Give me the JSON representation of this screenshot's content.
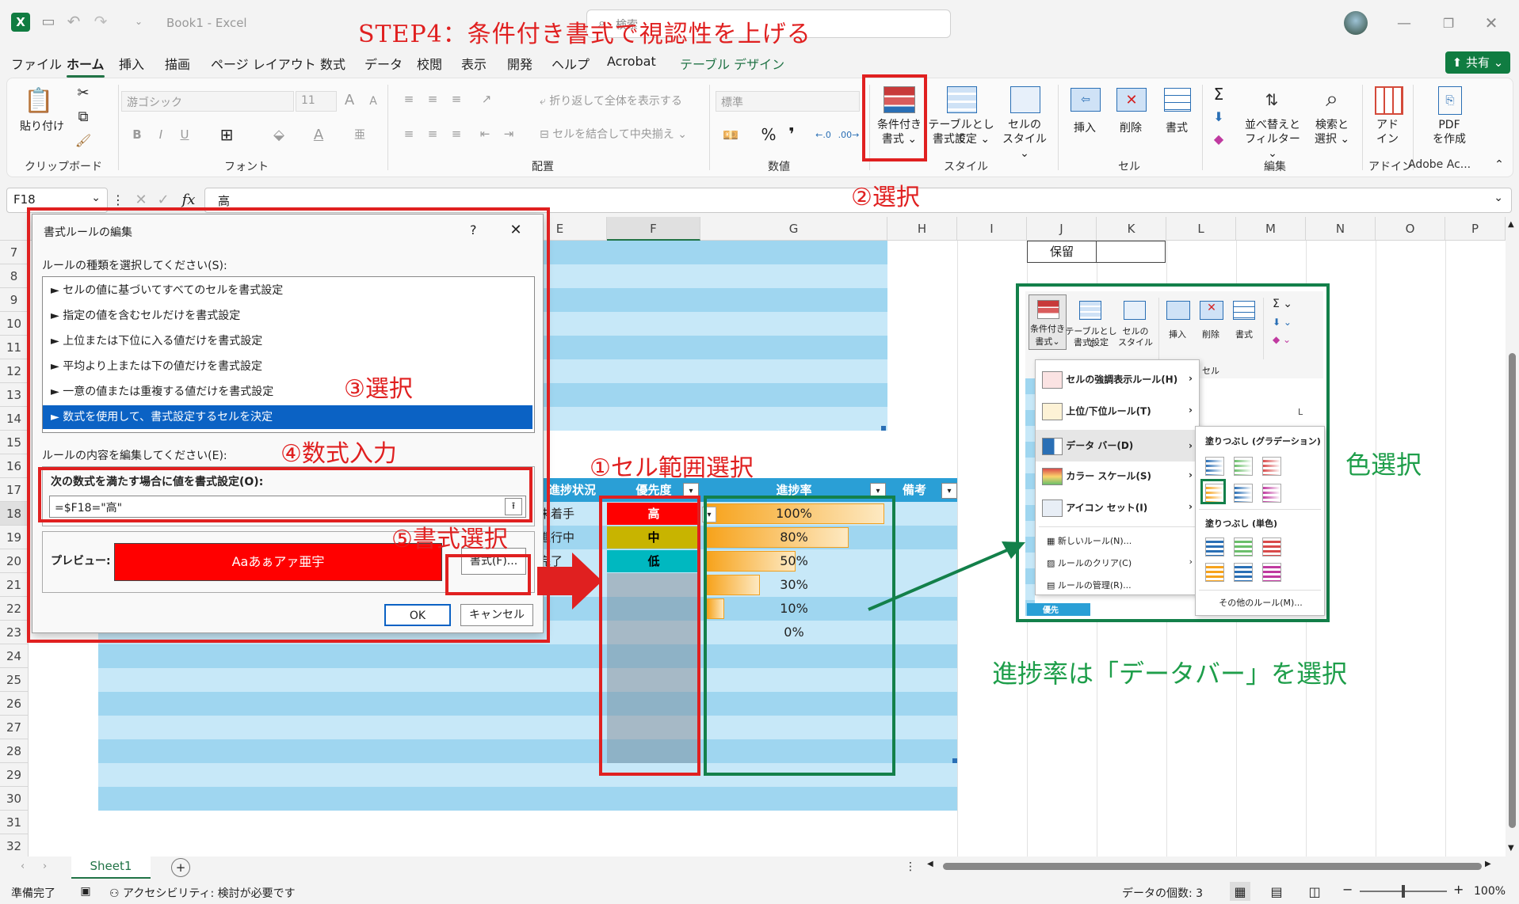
{
  "title": {
    "file": "Book1",
    "sep": "-",
    "app": "Excel",
    "search": "検索",
    "share": "共有"
  },
  "tabs": [
    "ファイル",
    "ホーム",
    "挿入",
    "描画",
    "ページ レイアウト",
    "数式",
    "データ",
    "校閲",
    "表示",
    "開発",
    "ヘルプ",
    "Acrobat",
    "テーブル デザイン"
  ],
  "ribbon": {
    "paste": "貼り付け",
    "clipboard": "クリップボード",
    "font_name": "游ゴシック",
    "font_size": "11",
    "font": "フォント",
    "wrap": "折り返して全体を表示する",
    "merge": "セルを結合して中央揃え",
    "align": "配置",
    "numfmt": "標準",
    "number": "数値",
    "cond_format_1": "条件付き",
    "cond_format_2": "書式",
    "table_fmt_1": "テーブルとして",
    "table_fmt_2": "書式設定",
    "cell_style_1": "セルの",
    "cell_style_2": "スタイル",
    "style": "スタイル",
    "insert": "挿入",
    "delete": "削除",
    "format": "書式",
    "cells": "セル",
    "sort_1": "並べ替えと",
    "sort_2": "フィルター",
    "find_1": "検索と",
    "find_2": "選択",
    "edit": "編集",
    "addin_1": "アド",
    "addin_2": "イン",
    "addin": "アドイン",
    "pdf_1": "PDF",
    "pdf_2": "を作成",
    "adobe": "Adobe Ac..."
  },
  "formula_bar": {
    "namebox": "F18",
    "fx": "fx",
    "value": "高"
  },
  "columns": [
    "E",
    "F",
    "G",
    "H",
    "I",
    "J",
    "K",
    "L",
    "M",
    "N",
    "O",
    "P"
  ],
  "rows": [
    "7",
    "8",
    "9",
    "10",
    "11",
    "12",
    "13",
    "14",
    "15",
    "16",
    "17",
    "18",
    "19",
    "20",
    "21",
    "22",
    "23",
    "24",
    "25",
    "26",
    "27",
    "28",
    "29",
    "30",
    "31",
    "32"
  ],
  "sheet": {
    "hold": "保留",
    "headers": {
      "status": "進捗状況",
      "priority": "優先度",
      "progress": "進捗率",
      "notes": "備考"
    },
    "status_values": [
      "未着手",
      "進行中",
      "完了"
    ],
    "priority_values": [
      {
        "label": "高",
        "color": "#ff0000",
        "text": "#ffffff"
      },
      {
        "label": "中",
        "color": "#c8b400",
        "text": "#000000"
      },
      {
        "label": "低",
        "color": "#00b8c0",
        "text": "#000000"
      }
    ],
    "progress_values": [
      {
        "label": "100%",
        "value": 1.0
      },
      {
        "label": "80%",
        "value": 0.8
      },
      {
        "label": "50%",
        "value": 0.5
      },
      {
        "label": "30%",
        "value": 0.3
      },
      {
        "label": "10%",
        "value": 0.1
      },
      {
        "label": "0%",
        "value": 0.0
      }
    ]
  },
  "dialog": {
    "title": "書式ルールの編集",
    "help": "?",
    "rule_type_label": "ルールの種類を選択してください(S):",
    "rules": [
      "セルの値に基づいてすべてのセルを書式設定",
      "指定の値を含むセルだけを書式設定",
      "上位または下位に入る値だけを書式設定",
      "平均より上または下の値だけを書式設定",
      "一意の値または重複する値だけを書式設定",
      "数式を使用して、書式設定するセルを決定"
    ],
    "edit_label": "ルールの内容を編集してください(E):",
    "formula_label": "次の数式を満たす場合に値を書式設定(O):",
    "formula": "=$F18=\"高\"",
    "preview_label": "プレビュー:",
    "preview_text": "Aaあぁアァ亜宇",
    "format_button": "書式(F)...",
    "ok": "OK",
    "cancel": "キャンセル"
  },
  "inset": {
    "cond_1": "条件付き",
    "cond_2": "書式",
    "table_1": "テーブルとして",
    "table_2": "書式設定",
    "cell_1": "セルの",
    "cell_2": "スタイル",
    "insert": "挿入",
    "delete": "削除",
    "format": "書式",
    "cells": "セル",
    "col_k": "K",
    "col_l": "L",
    "menu": [
      "セルの強調表示ルール(H)",
      "上位/下位ルール(T)",
      "データ バー(D)",
      "カラー スケール(S)",
      "アイコン セット(I)"
    ],
    "menu_small": [
      "新しいルール(N)...",
      "ルールのクリア(C)",
      "ルールの管理(R)..."
    ],
    "gradient_title": "塗りつぶし (グラデーション)",
    "solid_title": "塗りつぶし (単色)",
    "other_rules": "その他のルール(M)...",
    "bottom_text": "優先"
  },
  "annotations": {
    "step": "STEP4：条件付き書式で視認性を上げる",
    "a1": "①セル範囲選択",
    "a2": "②選択",
    "a3": "③選択",
    "a4": "④数式入力",
    "a5": "⑤書式選択",
    "color_select": "色選択",
    "databar": "進捗率は「データバー」を選択"
  },
  "sheet_tab": "Sheet1",
  "status": {
    "ready": "準備完了",
    "accessibility": "アクセシビリティ: 検討が必要です",
    "count": "データの個数: 3",
    "zoom": "100%"
  }
}
